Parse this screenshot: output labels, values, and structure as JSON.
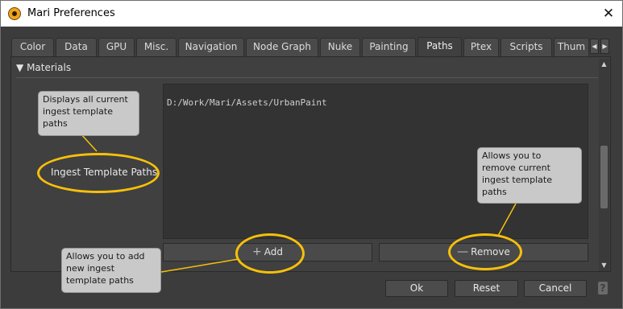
{
  "window": {
    "title": "Mari Preferences",
    "close_glyph": "✕"
  },
  "tabs": [
    {
      "label": "Color"
    },
    {
      "label": "Data"
    },
    {
      "label": "GPU"
    },
    {
      "label": "Misc."
    },
    {
      "label": "Navigation"
    },
    {
      "label": "Node Graph"
    },
    {
      "label": "Nuke"
    },
    {
      "label": "Painting"
    },
    {
      "label": "Paths"
    },
    {
      "label": "Ptex"
    },
    {
      "label": "Scripts"
    },
    {
      "label": "Thum"
    }
  ],
  "active_tab": "Paths",
  "tab_scroll": {
    "left": "◀",
    "right": "▶"
  },
  "section": {
    "label": "Materials",
    "arrow": "▼"
  },
  "field": {
    "label": "Ingest Template Paths",
    "paths": [
      "D:/Work/Mari/Assets/UrbanPaint"
    ],
    "add_label": "Add",
    "add_icon": "+",
    "remove_label": "Remove",
    "remove_icon": "—"
  },
  "scrollbar": {
    "up": "▲",
    "down": "▼"
  },
  "dialog_buttons": {
    "ok": "Ok",
    "reset": "Reset",
    "cancel": "Cancel",
    "help": "?"
  },
  "callouts": {
    "display": "Displays all current ingest template paths",
    "remove": "Allows you to remove current ingest template paths",
    "add": "Allows you to add new ingest template paths"
  },
  "colors": {
    "halo": "#f7c00a",
    "callout_bg": "#c9c9c9",
    "panel": "#404040"
  }
}
